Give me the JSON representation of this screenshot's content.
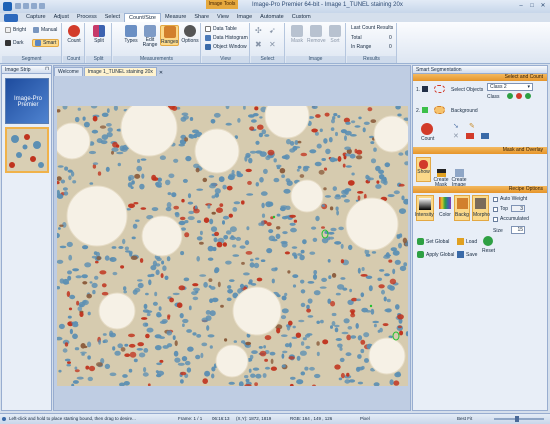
{
  "titlebar": {
    "tools_label": "Image Tools",
    "title": "Image-Pro Premier 64-bit - Image 1_TUNEL staining 20x"
  },
  "menu": {
    "tabs": [
      "Capture",
      "Adjust",
      "Process",
      "Select",
      "Count/Size",
      "Measure",
      "Share",
      "View",
      "Image",
      "Automate",
      "Custom"
    ],
    "active": "Count/Size"
  },
  "ribbon": {
    "segment": {
      "bright": "Bright",
      "dark": "Dark",
      "manual": "Manual",
      "smart": "Smart",
      "label": "Segment"
    },
    "count": {
      "count": "Count",
      "label": "Count"
    },
    "split": {
      "split": "Split",
      "label": "Split"
    },
    "measurements": {
      "types": "Types",
      "edit_range": "Edit\nRange",
      "ranges": "Ranges",
      "options": "Options",
      "label": "Measurements"
    },
    "view": {
      "data_table": "Data Table",
      "data_histogram": "Data Histogram",
      "object_window": "Object Window",
      "label": "View"
    },
    "select": {
      "label": "Select"
    },
    "image": {
      "mask": "Mask",
      "remove": "Remove",
      "sort": "Sort",
      "label": "Image"
    },
    "results": {
      "last_count": "Last Count Results",
      "total_label": "Total",
      "total_value": "0",
      "in_range_label": "In Range",
      "in_range_value": "0",
      "label": "Results"
    }
  },
  "image_strip": {
    "title": "Image Strip",
    "thumb_logo": "Image-Pro Premier"
  },
  "doc_tabs": [
    "Welcome",
    "Image 1_TUNEL staining 20x"
  ],
  "smart_seg": {
    "title": "Smart Segmentation",
    "select_count": "Select and Count",
    "row1_num": "1.",
    "row1_label": "Select Objects",
    "class_value": "Class 2",
    "class_label": "Class",
    "row2_num": "2.",
    "row2_label": "Background",
    "count_label": "Count",
    "mask_overlay": "Mask and Overlay",
    "show": "Show",
    "create_mask": "Create\nMask",
    "create_image": "Create\nImage",
    "recipe_options": "Recipe Options",
    "intensity": "Intensity",
    "color": "Color",
    "backg": "Backg",
    "morpho": "Morpho",
    "auto_weight": "Auto Weight",
    "top": "Top",
    "top_value": "3",
    "accumulated": "Accumulated",
    "size": "Size",
    "size_value": "15",
    "set_global": "Set Global",
    "apply_global": "Apply Global",
    "load": "Load",
    "save": "Save",
    "reset": "Reset"
  },
  "status": {
    "hint": "Left-click and hold to place starting bound, then drag to desire...",
    "frame": "Frame: 1 / 1",
    "time": "06:16:13",
    "xy": "(X,Y): 1872, 1819",
    "rgb": "RGB:  164 , 149 , 126",
    "unit": "Pixel",
    "fit": "Best Fit"
  },
  "colors": {
    "accent": "#e6952a",
    "ribbon_hl": "#fbd98a",
    "nucleus_blue": "#5c8fb3",
    "tunel_red": "#c0331e"
  }
}
